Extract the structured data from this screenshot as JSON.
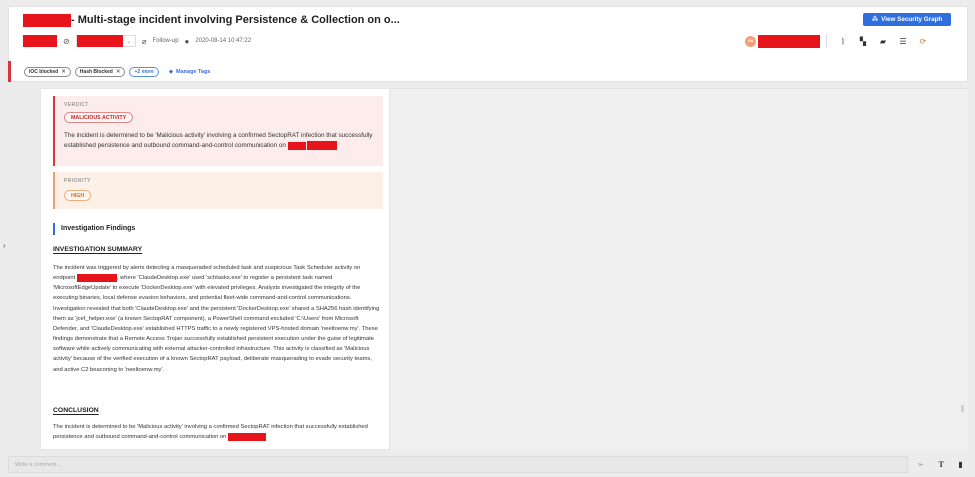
{
  "header": {
    "title": "- Multi-stage incident involving Persistence & Collection on o...",
    "graph_button_label": "View Security Graph",
    "follow_up_label": "Follow-up",
    "timestamp": "2020-08-14 10:47:22",
    "avatar_initials": "ON"
  },
  "tags": {
    "items": [
      "IOC blocked",
      "Hash Blocked"
    ],
    "more_label": "+2 more",
    "manage_label": "Manage Tags"
  },
  "verdict": {
    "label": "VERDICT",
    "value": "MALICIOUS ACTIVITY",
    "description": "The incident is determined to be 'Malicious activity' involving a confirmed SectopRAT infection that successfully established persistence and outbound command-and-control communication on"
  },
  "priority": {
    "label": "PRIORITY",
    "value": "HIGH"
  },
  "findings": {
    "heading": "Investigation Findings",
    "summary_heading": "INVESTIGATION SUMMARY",
    "summary_part1": "The incident was triggered by alerts detecting a masqueraded scheduled task and suspicious Task Scheduler activity on endpoint",
    "summary_part2": ", where 'ClaudeDesktop.exe' used 'schtasks.exe' to register a persistent task named 'MicrosoftEdgeUpdate' to execute 'DockerDesktop.exe' with elevated privileges. Analysts investigated the integrity of the executing binaries, local defense evasion behaviors, and potential fleet-wide command-and-control communications. Investigation revealed that both 'ClaudeDesktop.exe' and the persistent 'DockerDesktop.exe' shared a SHA256 hash identifying them as 'jcef_helper.exe' (a known SectopRAT component), a PowerShell command excluded 'C:\\Users' from Microsoft Defender, and 'ClaudeDesktop.exe' established HTTPS traffic to a newly registered VPS-hosted domain 'neeltoenw.my'. These findings demonstrate that a Remote Access Trojan successfully established persistent execution under the guise of legitimate software while actively communicating with external attacker-controlled infrastructure. This activity is classified as 'Malicious activity' because of the verified execution of a known SectopRAT payload, deliberate masquerading to evade security teams, and active C2 beaconing to 'neeltoenw.my'.",
    "conclusion_heading": "CONCLUSION",
    "conclusion_text": "The incident is determined to be 'Malicious activity' involving a confirmed SectopRAT infection that successfully established persistence and outbound command-and-control communication on"
  },
  "comment": {
    "placeholder": "Write a comment..."
  }
}
